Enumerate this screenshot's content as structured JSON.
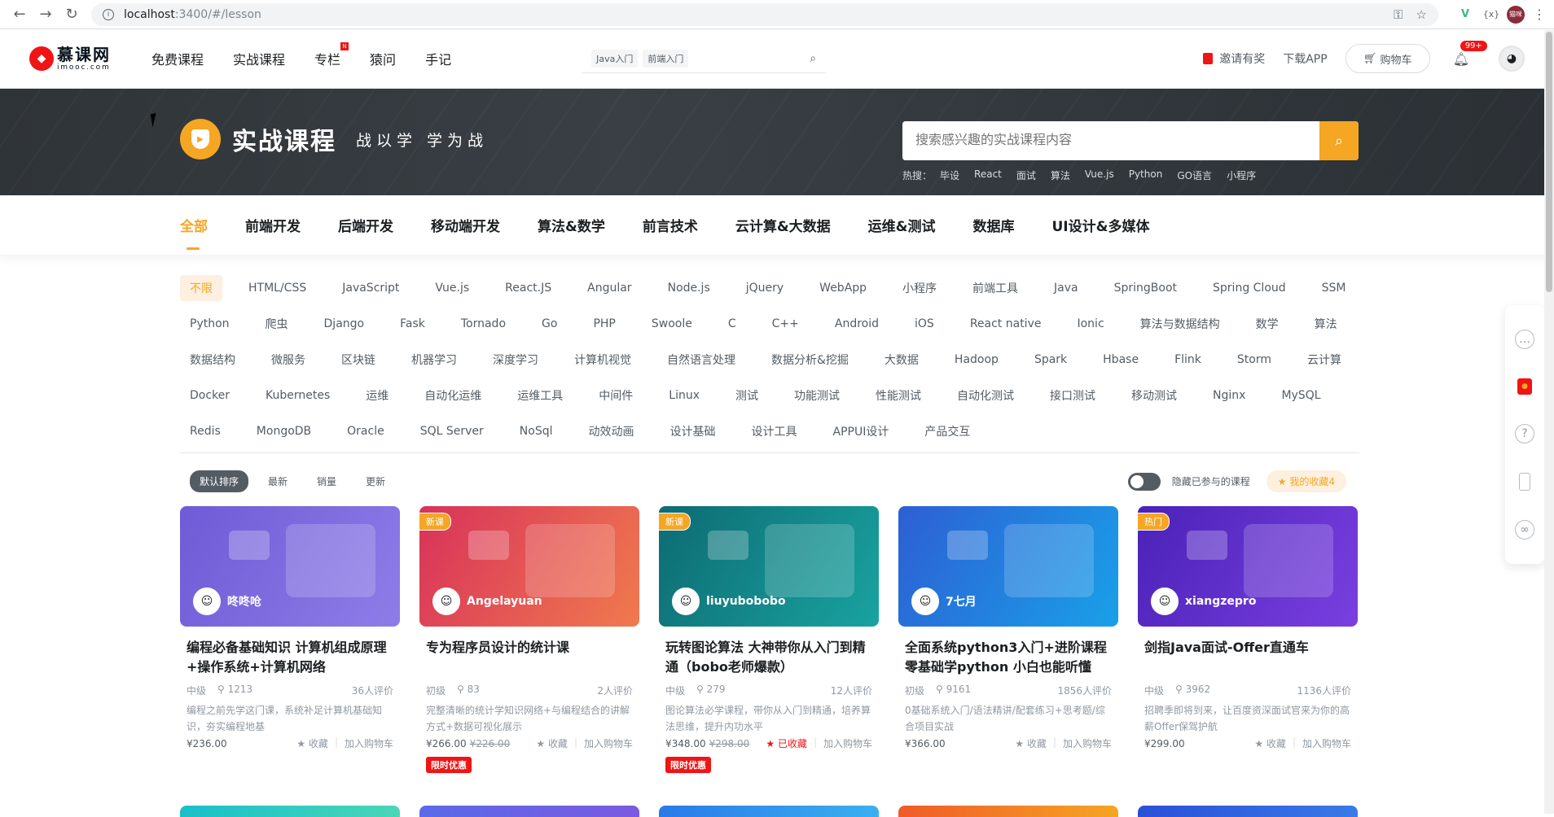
{
  "browser": {
    "url_host": "localhost",
    "url_rest": ":3400/#/lesson",
    "profile": "猫咪"
  },
  "header": {
    "logo_cn": "慕课网",
    "logo_en": "imooc.com",
    "nav": [
      "免费课程",
      "实战课程",
      "专栏",
      "猿问",
      "手记"
    ],
    "search_tags": [
      "Java入门",
      "前端入门"
    ],
    "invite": "邀请有奖",
    "download": "下载APP",
    "cart": "购物车",
    "notice_badge": "99+"
  },
  "banner": {
    "title": "实战课程",
    "slogan": "战以学 学为战",
    "search_placeholder": "搜索感兴趣的实战课程内容",
    "hot_label": "热搜：",
    "hot": [
      "毕设",
      "React",
      "面试",
      "算法",
      "Vue.js",
      "Python",
      "GO语言",
      "小程序"
    ]
  },
  "categories": [
    "全部",
    "前端开发",
    "后端开发",
    "移动端开发",
    "算法&数学",
    "前言技术",
    "云计算&大数据",
    "运维&测试",
    "数据库",
    "UI设计&多媒体"
  ],
  "tag_rows": [
    [
      "不限",
      "HTML/CSS",
      "JavaScript",
      "Vue.js",
      "React.JS",
      "Angular",
      "Node.js",
      "jQuery",
      "WebApp",
      "小程序",
      "前端工具",
      "Java",
      "SpringBoot",
      "Spring Cloud",
      "SSM"
    ],
    [
      "Python",
      "爬虫",
      "Django",
      "Fask",
      "Tornado",
      "Go",
      "PHP",
      "Swoole",
      "C",
      "C++",
      "Android",
      "iOS",
      "React native",
      "Ionic",
      "算法与数据结构",
      "数学",
      "算法"
    ],
    [
      "数据结构",
      "微服务",
      "区块链",
      "机器学习",
      "深度学习",
      "计算机视觉",
      "自然语言处理",
      "数据分析&挖掘",
      "大数据",
      "Hadoop",
      "Spark",
      "Hbase",
      "Flink",
      "Storm",
      "云计算"
    ],
    [
      "Docker",
      "Kubernetes",
      "运维",
      "自动化运维",
      "运维工具",
      "中间件",
      "Linux",
      "测试",
      "功能测试",
      "性能测试",
      "自动化测试",
      "接口测试",
      "移动测试",
      "Nginx",
      "MySQL"
    ],
    [
      "Redis",
      "MongoDB",
      "Oracle",
      "SQL Server",
      "NoSql",
      "动效动画",
      "设计基础",
      "设计工具",
      "APPUI设计",
      "产品交互"
    ]
  ],
  "sort": {
    "options": [
      "默认排序",
      "最新",
      "销量",
      "更新"
    ],
    "hide_label": "隐藏已参与的课程",
    "fav_label": "我的收藏4"
  },
  "course_labels": {
    "fav": "收藏",
    "faved": "已收藏",
    "add_cart": "加入购物车",
    "limit": "限时优惠"
  },
  "courses": [
    {
      "badge": "",
      "teacher": "咚咚呛",
      "title": "编程必备基础知识 计算机组成原理+操作系统+计算机网络",
      "level": "中级",
      "students": "1213",
      "reviews": "36人评价",
      "desc": "编程之前先学这门课，系统补足计算机基础知识，夯实编程地基",
      "price": "¥236.00",
      "old_price": "",
      "faved": false,
      "limit": false,
      "colors": [
        "#6f5bd6",
        "#8e7de8"
      ]
    },
    {
      "badge": "新课",
      "teacher": "Angelayuan",
      "title": "专为程序员设计的统计课",
      "level": "初级",
      "students": "83",
      "reviews": "2人评价",
      "desc": "完整清晰的统计学知识网络+与编程结合的讲解方式+数据可视化展示",
      "price": "¥266.00",
      "old_price": "¥226.00",
      "faved": false,
      "limit": true,
      "colors": [
        "#d8325a",
        "#f07a4e"
      ]
    },
    {
      "badge": "新课",
      "teacher": "liuyubobobo",
      "title": "玩转图论算法 大神带你从入门到精通（bobo老师爆款）",
      "level": "中级",
      "students": "279",
      "reviews": "12人评价",
      "desc": "图论算法必学课程，带你从入门到精通，培养算法思维，提升内功水平",
      "price": "¥348.00",
      "old_price": "¥298.00",
      "faved": true,
      "limit": true,
      "colors": [
        "#0d6b73",
        "#19a3a0"
      ]
    },
    {
      "badge": "",
      "teacher": "7七月",
      "title": "全面系统python3入门+进阶课程 零基础学python 小白也能听懂",
      "level": "初级",
      "students": "9161",
      "reviews": "1856人评价",
      "desc": "0基础系统入门/语法精讲/配套练习+思考题/综合项目实战",
      "price": "¥366.00",
      "old_price": "",
      "faved": false,
      "limit": false,
      "colors": [
        "#2d5fd4",
        "#1aa0e8"
      ]
    },
    {
      "badge": "热门",
      "teacher": "xiangzepro",
      "title": "剑指Java面试-Offer直通车",
      "level": "中级",
      "students": "3962",
      "reviews": "1136人评价",
      "desc": "招聘季即将到来，让百度资深面试官来为你的高薪Offer保驾护航",
      "price": "¥299.00",
      "old_price": "",
      "faved": false,
      "limit": false,
      "colors": [
        "#4a22b8",
        "#7a3fe0"
      ]
    }
  ]
}
